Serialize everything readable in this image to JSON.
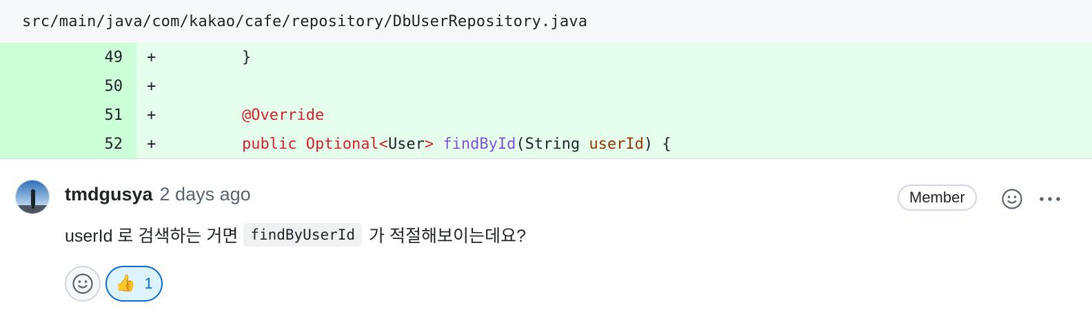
{
  "file": {
    "path": "src/main/java/com/kakao/cafe/repository/DbUserRepository.java"
  },
  "diff": {
    "lines": [
      {
        "number": "49",
        "marker": "+",
        "tokens": [
          {
            "text": "    }",
            "kind": "plain"
          }
        ]
      },
      {
        "number": "50",
        "marker": "+",
        "tokens": []
      },
      {
        "number": "51",
        "marker": "+",
        "tokens": [
          {
            "text": "    ",
            "kind": "plain"
          },
          {
            "text": "@Override",
            "kind": "kw"
          }
        ]
      },
      {
        "number": "52",
        "marker": "+",
        "tokens": [
          {
            "text": "    ",
            "kind": "plain"
          },
          {
            "text": "public",
            "kind": "kw"
          },
          {
            "text": " ",
            "kind": "plain"
          },
          {
            "text": "Optional<",
            "kind": "kw"
          },
          {
            "text": "User",
            "kind": "plain"
          },
          {
            "text": ">",
            "kind": "kw"
          },
          {
            "text": " ",
            "kind": "plain"
          },
          {
            "text": "findById",
            "kind": "fn"
          },
          {
            "text": "(String ",
            "kind": "plain"
          },
          {
            "text": "userId",
            "kind": "var"
          },
          {
            "text": ") {",
            "kind": "plain"
          }
        ]
      }
    ]
  },
  "comment": {
    "author": "tmdgusya",
    "timestamp": "2 days ago",
    "badge": "Member",
    "body_before": "userId 로 검색하는 거면",
    "body_code": "findByUserId",
    "body_after": "가 적절해보이는데요?",
    "reactions": [
      {
        "emoji": "👍",
        "count": "1"
      }
    ]
  },
  "icons": {
    "emoji_picker": "smiley-icon",
    "more_options": "kebab-horizontal-icon",
    "avatar": "user-avatar"
  },
  "colors": {
    "line_number_bg": "#ccffd8",
    "code_added_bg": "#e6ffec",
    "keyword": "#cf222e",
    "function": "#8250df",
    "variable": "#953800",
    "reaction_accent": "#0969da"
  }
}
